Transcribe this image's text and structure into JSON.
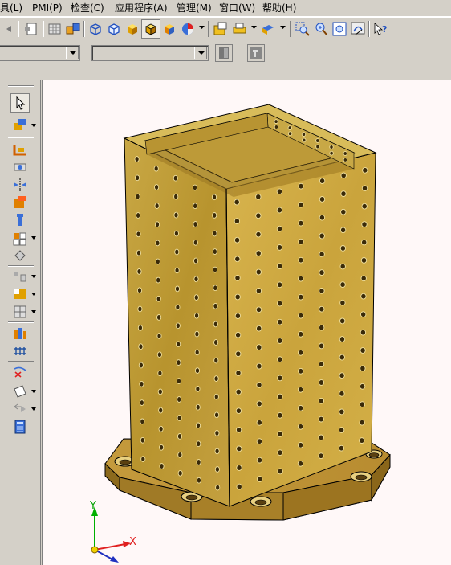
{
  "menubar": {
    "items": [
      {
        "label": "具(L)"
      },
      {
        "label": "PMI(P)"
      },
      {
        "label": "检查(C)"
      },
      {
        "label": "应用程序(A)"
      },
      {
        "label": "管理(M)"
      },
      {
        "label": "窗口(W)"
      },
      {
        "label": "帮助(H)"
      }
    ]
  },
  "toolbar_top": {
    "icons": [
      "back-icon",
      "sheet-icon",
      "grid-icon",
      "parts-icon",
      "wireframe-cube-icon",
      "hidden-line-cube-icon",
      "shaded-cube-icon",
      "shaded-edges-cube-icon",
      "studio-cube-icon",
      "sphere-render-icon",
      "dropdown-icon",
      "folder-open-icon",
      "print-icon",
      "dropdown-icon",
      "view-orient-icon",
      "dropdown-icon",
      "zoom-window-icon",
      "zoom-icon",
      "zoom-fit-icon",
      "rotate-icon",
      "help-cursor-icon"
    ]
  },
  "toolbar_second": {
    "combo1_value": "",
    "combo2_value": ""
  },
  "left_toolbar": {
    "icons": [
      "select-arrow-icon",
      "part-move-icon",
      "assemble-icon",
      "constraint-icon",
      "mirror-icon",
      "component-icon",
      "fastener-icon",
      "pattern-icon",
      "diamond-icon",
      "exploded-view-icon",
      "cutaway-icon",
      "grid-view-icon",
      "bom-icon",
      "mesh-icon",
      "variables-icon",
      "plane-icon",
      "arrow-play-icon",
      "calculator-icon"
    ]
  },
  "viewport": {
    "axis_labels": {
      "x": "X",
      "y": "Y"
    },
    "model": "hollow square column with perforated walls on octagonal base plate",
    "model_color": "#c9a845"
  }
}
